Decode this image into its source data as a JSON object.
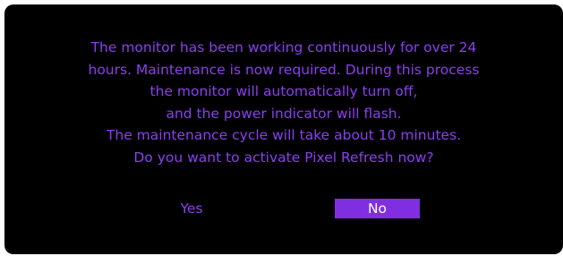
{
  "dialog": {
    "message_lines": [
      "The monitor has been working continuously for over 24",
      "hours. Maintenance is now required. During this process",
      "the monitor will automatically turn off,",
      "and the power indicator will flash.",
      "The maintenance cycle will take about 10 minutes.",
      "Do you want to activate Pixel Refresh now?"
    ],
    "buttons": {
      "yes_label": "Yes",
      "no_label": "No",
      "selected": "No"
    },
    "colors": {
      "background": "#000000",
      "text": "#8a3ff0",
      "selected_button_bg": "#7f2fe0",
      "selected_button_text": "#ffffff"
    }
  }
}
